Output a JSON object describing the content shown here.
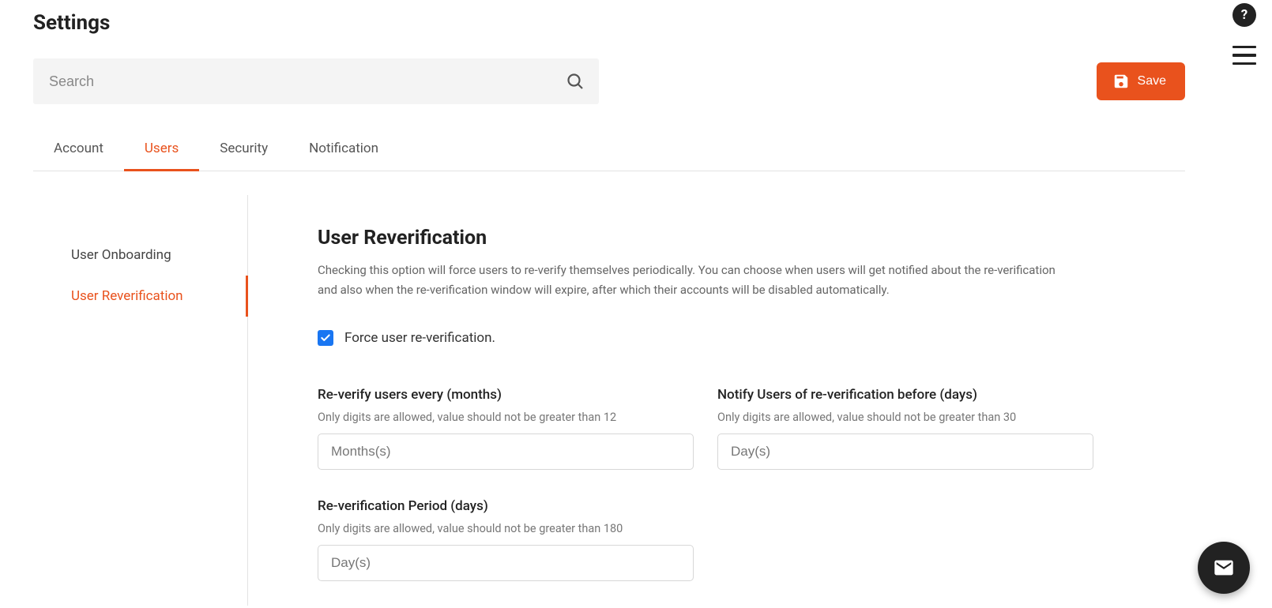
{
  "page_title": "Settings",
  "search": {
    "placeholder": "Search",
    "value": ""
  },
  "save_button_label": "Save",
  "tabs": [
    {
      "label": "Account",
      "active": false
    },
    {
      "label": "Users",
      "active": true
    },
    {
      "label": "Security",
      "active": false
    },
    {
      "label": "Notification",
      "active": false
    }
  ],
  "sidebar": {
    "items": [
      {
        "label": "User Onboarding",
        "active": false
      },
      {
        "label": "User Reverification",
        "active": true
      }
    ]
  },
  "section": {
    "title": "User Reverification",
    "description": "Checking this option will force users to re-verify themselves periodically. You can choose when users will get notified about the re-verification and also when the re-verification window will expire, after which their accounts will be disabled automatically."
  },
  "checkbox": {
    "checked": true,
    "label": "Force user re-verification."
  },
  "fields": {
    "reverify_every": {
      "label": "Re-verify users every (months)",
      "hint": "Only digits are allowed, value should not be greater than 12",
      "placeholder": "Months(s)",
      "value": ""
    },
    "notify_before": {
      "label": "Notify Users of re-verification before (days)",
      "hint": "Only digits are allowed, value should not be greater than 30",
      "placeholder": "Day(s)",
      "value": ""
    },
    "reverify_period": {
      "label": "Re-verification Period (days)",
      "hint": "Only digits are allowed, value should not be greater than 180",
      "placeholder": "Day(s)",
      "value": ""
    }
  },
  "colors": {
    "accent": "#e9521d",
    "checkbox": "#1976f2"
  }
}
